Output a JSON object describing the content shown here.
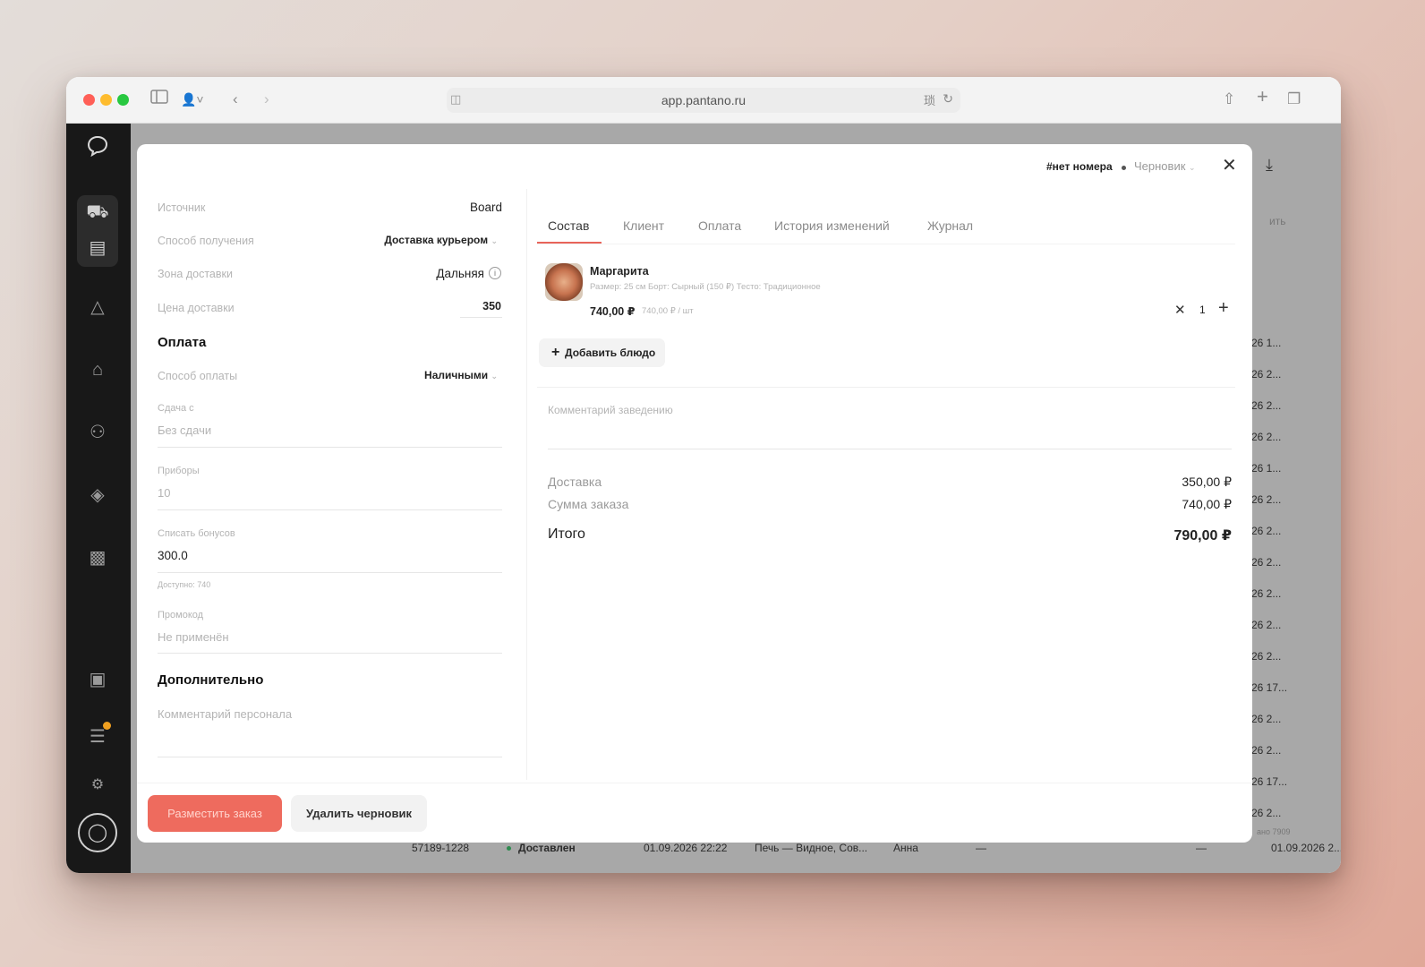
{
  "browser": {
    "url": "app.pantano.ru"
  },
  "background_table": {
    "header_fragment": "ить",
    "date_fragments": [
      "26 1...",
      "26 2...",
      "26 2...",
      "26 2...",
      "26 1...",
      "26 2...",
      "26 2...",
      "26 2...",
      "26 2...",
      "26 2...",
      "26 2...",
      "26 17...",
      "26 2...",
      "26 2...",
      "26 17...",
      "26 2..."
    ],
    "footer_row": {
      "id": "57189-1228",
      "status": "Доставлен",
      "date": "01.09.2026 22:22",
      "place": "Печь — Видное, Сов...",
      "courier": "Анна",
      "dash1": "—",
      "dash2": "—",
      "date2": "01.09.2026 2..."
    },
    "side_note": "ано 7909"
  },
  "modal": {
    "order_number": "#нет номера",
    "status": "Черновик",
    "left": {
      "source_label": "Источник",
      "source_value": "Board",
      "receive_label": "Способ получения",
      "receive_value": "Доставка курьером",
      "zone_label": "Зона доставки",
      "zone_value": "Дальняя",
      "price_label": "Цена доставки",
      "price_value": "350",
      "payment_heading": "Оплата",
      "pay_method_label": "Способ оплаты",
      "pay_method_value": "Наличными",
      "change_label": "Сдача с",
      "change_placeholder": "Без сдачи",
      "utensils_label": "Приборы",
      "utensils_value": "10",
      "bonus_label": "Списать бонусов",
      "bonus_value": "300.0",
      "bonus_hint": "Доступно: 740",
      "promo_label": "Промокод",
      "promo_value": "Не применён",
      "extra_heading": "Дополнительно",
      "staff_comment_placeholder": "Комментарий персонала"
    },
    "tabs": [
      "Состав",
      "Клиент",
      "Оплата",
      "История изменений",
      "Журнал"
    ],
    "item": {
      "name": "Маргарита",
      "details": "Размер: 25 см Борт: Сырный (150 ₽) Тесто: Традиционное",
      "price": "740,00 ₽",
      "unit_price": "740,00 ₽ / шт",
      "qty": "1"
    },
    "add_dish": "Добавить блюдо",
    "venue_comment_placeholder": "Комментарий заведению",
    "totals": {
      "delivery_label": "Доставка",
      "delivery_value": "350,00 ₽",
      "sum_label": "Сумма заказа",
      "sum_value": "740,00 ₽",
      "total_label": "Итого",
      "total_value": "790,00 ₽"
    },
    "place_order": "Разместить заказ",
    "delete_draft": "Удалить черновик"
  },
  "colors": {
    "accent": "#ee6b5e",
    "sidebar": "#181818",
    "notification_dot": "#f0a020"
  }
}
